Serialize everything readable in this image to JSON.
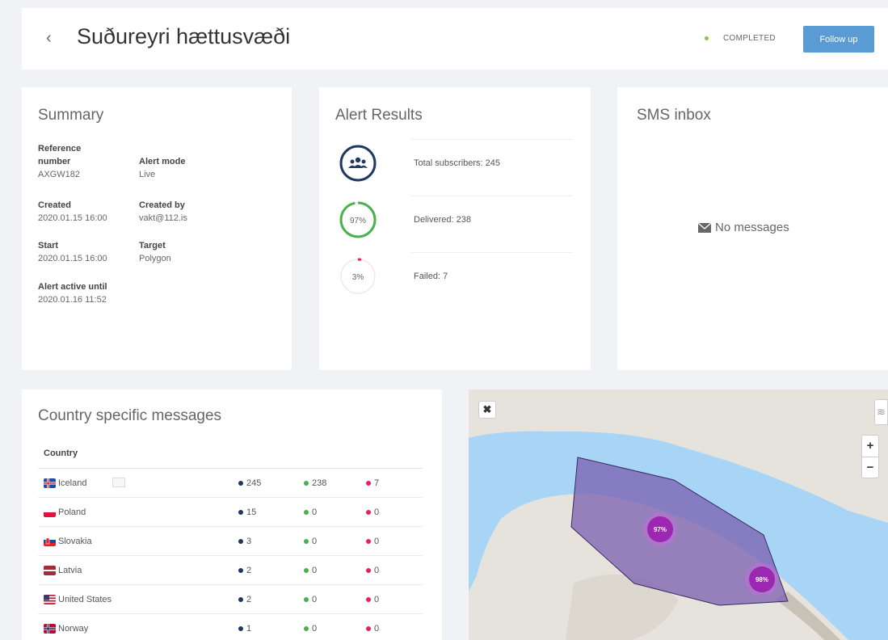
{
  "header": {
    "back": "‹",
    "title": "Suðureyri hættusvæði",
    "status": "COMPLETED",
    "follow_up": "Follow up"
  },
  "summary": {
    "title": "Summary",
    "fields": [
      {
        "label": "Reference\nnumber",
        "value": "AXGW182"
      },
      {
        "label": "Alert mode",
        "value": "Live"
      },
      {
        "label": "Created",
        "value": "2020.01.15 16:00"
      },
      {
        "label": "Created by",
        "value": "vakt@112.is"
      },
      {
        "label": "Start",
        "value": "2020.01.15 16:00"
      },
      {
        "label": "Target",
        "value": "Polygon"
      },
      {
        "label": "Alert active until",
        "value": "2020.01.16 11:52"
      }
    ]
  },
  "results": {
    "title": "Alert Results",
    "rows": [
      {
        "label": "Total subscribers: 245",
        "icon": "people-icon"
      },
      {
        "label": "Delivered: 238",
        "pct": "97%",
        "fraction": 0.97
      },
      {
        "label": "Failed: 7",
        "pct": "3%",
        "fraction": 0.03
      }
    ]
  },
  "sms": {
    "title": "SMS inbox",
    "empty": "No messages",
    "icon": "envelope-icon"
  },
  "country": {
    "title": "Country specific messages",
    "header": "Country",
    "rows": [
      {
        "name": "Iceland",
        "total": "245",
        "delivered": "238",
        "failed": "7",
        "flag": "iceland"
      },
      {
        "name": "Poland",
        "total": "15",
        "delivered": "0",
        "failed": "0",
        "flag": "poland"
      },
      {
        "name": "Slovakia",
        "total": "3",
        "delivered": "0",
        "failed": "0",
        "flag": "slovakia"
      },
      {
        "name": "Latvia",
        "total": "2",
        "delivered": "0",
        "failed": "0",
        "flag": "latvia"
      },
      {
        "name": "United States",
        "total": "2",
        "delivered": "0",
        "failed": "0",
        "flag": "usa"
      },
      {
        "name": "Norway",
        "total": "1",
        "delivered": "0",
        "failed": "0",
        "flag": "norway"
      }
    ]
  },
  "map": {
    "clusters": [
      {
        "label": "97%"
      },
      {
        "label": "98%"
      }
    ],
    "zoom_in": "+",
    "zoom_out": "−"
  },
  "colors": {
    "navy": "#1f3864",
    "green": "#4caf50",
    "red": "#e91e63",
    "button": "#5b9bd5",
    "status": "#8bc34a",
    "water": "#a8d4f5",
    "polygon": "#7a5fb0",
    "cluster": "#9c27b0"
  }
}
